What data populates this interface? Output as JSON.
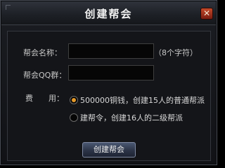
{
  "dialog": {
    "title": "创建帮会",
    "close_icon": "✕"
  },
  "form": {
    "name_label": "帮会名称：",
    "name_value": "",
    "name_hint": "（8个字符）",
    "qq_label": "帮会QQ群：",
    "qq_value": "",
    "fee_label": "费　　用：",
    "options": [
      {
        "label": "500000铜钱，创建15人的普通帮派",
        "selected": true
      },
      {
        "label": "建帮令，创建16人的二级帮派",
        "selected": false
      }
    ],
    "submit_label": "创建帮会"
  },
  "colors": {
    "accent": "#e59a2a",
    "close": "#c64a2a"
  }
}
